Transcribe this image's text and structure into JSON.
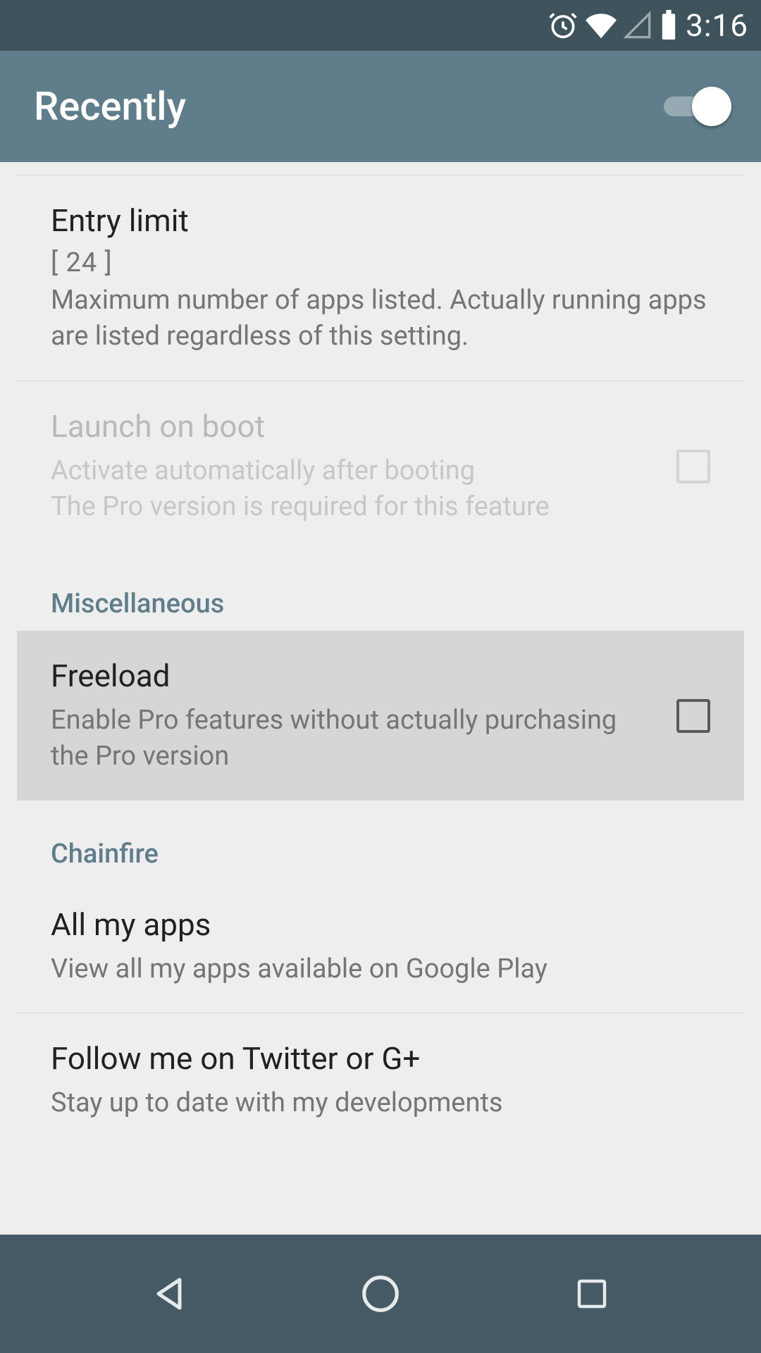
{
  "status": {
    "time": "3:16"
  },
  "appbar": {
    "title": "Recently",
    "toggle_on": true
  },
  "prefs": {
    "entry_limit": {
      "title": "Entry limit",
      "value": "[ 24 ]",
      "summary": "Maximum number of apps listed. Actually running apps are listed regardless of this setting."
    },
    "launch_on_boot": {
      "title": "Launch on boot",
      "summary": "Activate automatically after booting\nThe Pro version is required for this feature"
    },
    "section_misc": "Miscellaneous",
    "freeload": {
      "title": "Freeload",
      "summary": "Enable Pro features without actually purchasing the Pro version"
    },
    "section_chainfire": "Chainfire",
    "all_my_apps": {
      "title": "All my apps",
      "summary": "View all my apps available on Google Play"
    },
    "follow": {
      "title": "Follow me on Twitter or G+",
      "summary": "Stay up to date with my developments"
    }
  }
}
